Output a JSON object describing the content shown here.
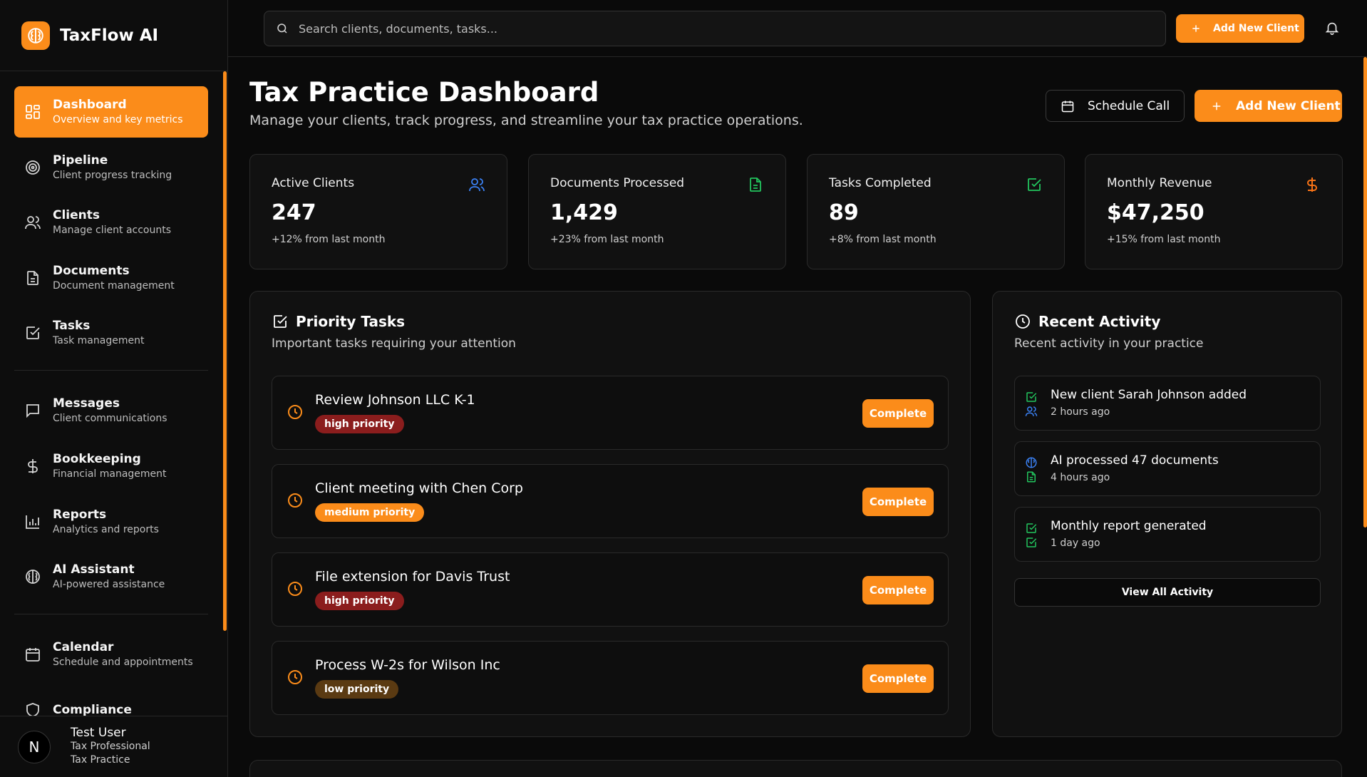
{
  "brand": {
    "name": "TaxFlow AI",
    "icon": "brain-icon",
    "accent": "#fb8c1a"
  },
  "search": {
    "placeholder": "Search clients, documents, tasks..."
  },
  "topbar": {
    "add_client": "Add New Client",
    "bell_icon": "bell-icon"
  },
  "sidebar": {
    "items": [
      {
        "label": "Dashboard",
        "sub": "Overview and key metrics",
        "icon": "dashboard-icon",
        "active": true
      },
      {
        "label": "Pipeline",
        "sub": "Client progress tracking",
        "icon": "target-icon"
      },
      {
        "label": "Clients",
        "sub": "Manage client accounts",
        "icon": "users-icon"
      },
      {
        "label": "Documents",
        "sub": "Document management",
        "icon": "document-icon"
      },
      {
        "label": "Tasks",
        "sub": "Task management",
        "icon": "checkbox-icon"
      },
      {
        "label": "Messages",
        "sub": "Client communications",
        "icon": "message-icon"
      },
      {
        "label": "Bookkeeping",
        "sub": "Financial management",
        "icon": "dollar-icon"
      },
      {
        "label": "Reports",
        "sub": "Analytics and reports",
        "icon": "bar-chart-icon"
      },
      {
        "label": "AI Assistant",
        "sub": "AI-powered assistance",
        "icon": "brain-icon"
      },
      {
        "label": "Calendar",
        "sub": "Schedule and appointments",
        "icon": "calendar-icon"
      },
      {
        "label": "Compliance",
        "sub": "",
        "icon": "shield-icon"
      }
    ]
  },
  "user": {
    "initial": "N",
    "name": "Test User",
    "role": "Tax Professional",
    "org": "Tax Practice"
  },
  "header": {
    "title": "Tax Practice Dashboard",
    "subtitle": "Manage your clients, track progress, and streamline your tax practice operations.",
    "schedule_call": "Schedule Call",
    "add_client": "Add New Client"
  },
  "stats": [
    {
      "label": "Active Clients",
      "value": "247",
      "change": "+12% from last month",
      "icon": "users-icon",
      "color": "#3b82f6"
    },
    {
      "label": "Documents Processed",
      "value": "1,429",
      "change": "+23% from last month",
      "icon": "document-icon",
      "color": "#22c55e"
    },
    {
      "label": "Tasks Completed",
      "value": "89",
      "change": "+8% from last month",
      "icon": "checkbox-icon",
      "color": "#22c55e"
    },
    {
      "label": "Monthly Revenue",
      "value": "$47,250",
      "change": "+15% from last month",
      "icon": "dollar-icon",
      "color": "#f97316"
    }
  ],
  "priority_tasks": {
    "title": "Priority Tasks",
    "subtitle": "Important tasks requiring your attention",
    "complete_label": "Complete",
    "items": [
      {
        "title": "Review Johnson LLC K-1",
        "priority": "high priority",
        "color": "#8b1d1d"
      },
      {
        "title": "Client meeting with Chen Corp",
        "priority": "medium priority",
        "color": "#fb8c1a"
      },
      {
        "title": "File extension for Davis Trust",
        "priority": "high priority",
        "color": "#8b1d1d"
      },
      {
        "title": "Process W-2s for Wilson Inc",
        "priority": "low priority",
        "color": "#5a3a12"
      }
    ]
  },
  "recent_activity": {
    "title": "Recent Activity",
    "subtitle": "Recent activity in your practice",
    "view_all": "View All Activity",
    "items": [
      {
        "title": "New client Sarah Johnson added",
        "time": "2 hours ago",
        "icons": [
          "checkbox-icon",
          "users-icon"
        ]
      },
      {
        "title": "AI processed 47 documents",
        "time": "4 hours ago",
        "icons": [
          "brain-icon",
          "document-icon"
        ]
      },
      {
        "title": "Monthly report generated",
        "time": "1 day ago",
        "icons": [
          "checkbox-icon",
          "checkbox-icon"
        ]
      }
    ]
  }
}
